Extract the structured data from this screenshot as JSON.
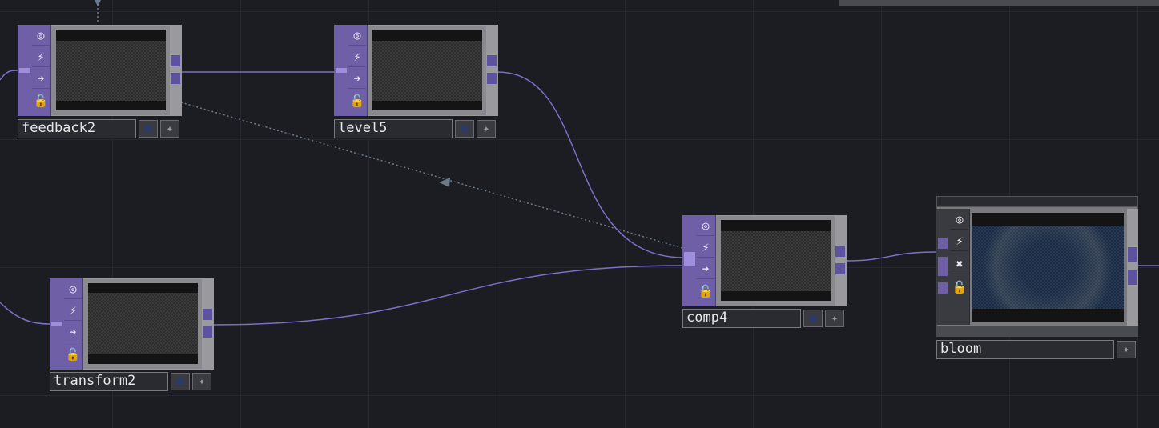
{
  "colors": {
    "background": "#1c1d22",
    "operator_bar": "#6f5fa6",
    "wire": "#7a6fc8",
    "reference_link": "#6a7a8a",
    "viewer_button": "#2b3a66"
  },
  "nodes": {
    "feedback2": {
      "name": "feedback2"
    },
    "level5": {
      "name": "level5"
    },
    "transform2": {
      "name": "transform2"
    },
    "comp4": {
      "name": "comp4"
    },
    "bloom": {
      "name": "bloom"
    }
  },
  "flag_icons": [
    "viewer-toggle-icon",
    "cook-icon",
    "display-icon",
    "lock-icon"
  ],
  "bloom_flag_icons": [
    "viewer-toggle-icon",
    "cook-icon",
    "bypass-icon",
    "lock-icon"
  ],
  "glyphs": {
    "viewer": "◎",
    "cook": "⚡",
    "display": "➔",
    "lock": "🔓",
    "bypass": "✖",
    "star": "✦",
    "ref_arrow": "◀"
  }
}
